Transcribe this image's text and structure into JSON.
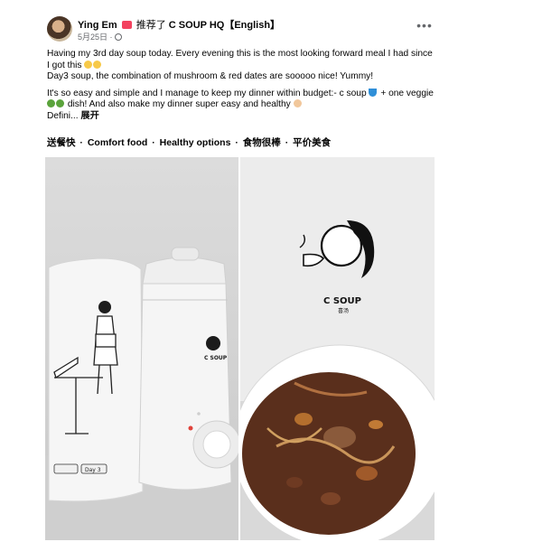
{
  "post": {
    "author": "Ying Em",
    "action": "推荐了",
    "page": "C SOUP HQ【English】",
    "date": "5月25日",
    "more_icon": "more-horizontal-icon",
    "paragraphs": [
      "Having my 3rd day soup today. Every evening this is the most looking forward meal I had since I got this",
      "Day3 soup,  the combination of mushroom & red dates are sooooo nice! Yummy!",
      "It's so easy and simple and I manage to keep my dinner within budget:- c soup",
      "+ one veggie",
      "dish!  And also make my dinner super easy and healthy",
      "Defini...",
      "展开"
    ],
    "tags": [
      "送餐快",
      "Comfort food",
      "Healthy options",
      "食物很棒",
      "平价美食"
    ],
    "tag_separator": "·"
  },
  "photos": {
    "left": {
      "bag_label": "Day 3",
      "cooker_brand": "C SOUP"
    },
    "right": {
      "box_brand": "C SOUP",
      "box_subtitle": "喜汤"
    }
  },
  "colors": {
    "badge": "#f3425f",
    "secondary_text": "#65676b",
    "soup": "#5a2f1c"
  }
}
